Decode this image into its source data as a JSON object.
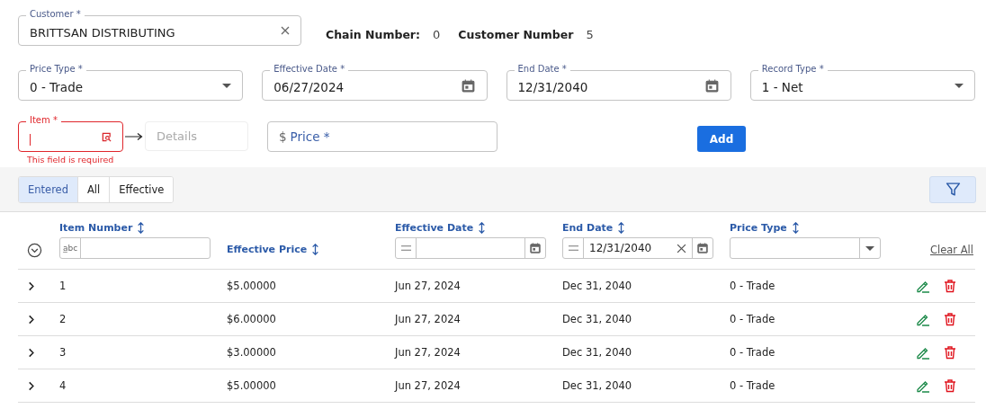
{
  "customer": {
    "label": "Customer *",
    "value": "BRITTSAN DISTRIBUTING"
  },
  "info": [
    {
      "label": "Chain Number:",
      "value": "0"
    },
    {
      "label": "Customer Number",
      "value": "5"
    }
  ],
  "fields": [
    {
      "kind": "select",
      "label": "Price Type *",
      "value": "0 - Trade"
    },
    {
      "kind": "date",
      "label": "Effective Date *",
      "value": "06/27/2024"
    },
    {
      "kind": "date",
      "label": "End Date *",
      "value": "12/31/2040"
    },
    {
      "kind": "select",
      "label": "Record Type *",
      "value": "1 - Net"
    }
  ],
  "item": {
    "label": "Item *",
    "focused": true,
    "error": "This field is required"
  },
  "details": {
    "placeholder": "Details"
  },
  "price": {
    "prefix": "$",
    "label": "Price *"
  },
  "add_button": "Add",
  "tabs": [
    {
      "label": "Entered",
      "selected": true
    },
    {
      "label": "All",
      "selected": false
    },
    {
      "label": "Effective",
      "selected": false
    }
  ],
  "table": {
    "columns": [
      {
        "label": "Item Number",
        "filter": {
          "kind": "text",
          "badge": "a̲bc"
        }
      },
      {
        "label": "Effective Price",
        "filter": {
          "kind": "none"
        }
      },
      {
        "label": "Effective Date",
        "filter": {
          "kind": "date"
        }
      },
      {
        "label": "End Date",
        "filter": {
          "kind": "date",
          "value": "12/31/2040"
        }
      },
      {
        "label": "Price Type",
        "filter": {
          "kind": "select"
        }
      }
    ],
    "clear_all": "Clear All",
    "rows": [
      {
        "cells": [
          "1",
          "$5.00000",
          "Jun 27, 2024",
          "Dec 31, 2040",
          "0 - Trade"
        ]
      },
      {
        "cells": [
          "2",
          "$6.00000",
          "Jun 27, 2024",
          "Dec 31, 2040",
          "0 - Trade"
        ]
      },
      {
        "cells": [
          "3",
          "$3.00000",
          "Jun 27, 2024",
          "Dec 31, 2040",
          "0 - Trade"
        ]
      },
      {
        "cells": [
          "4",
          "$5.00000",
          "Jun 27, 2024",
          "Dec 31, 2040",
          "0 - Trade"
        ]
      }
    ]
  }
}
